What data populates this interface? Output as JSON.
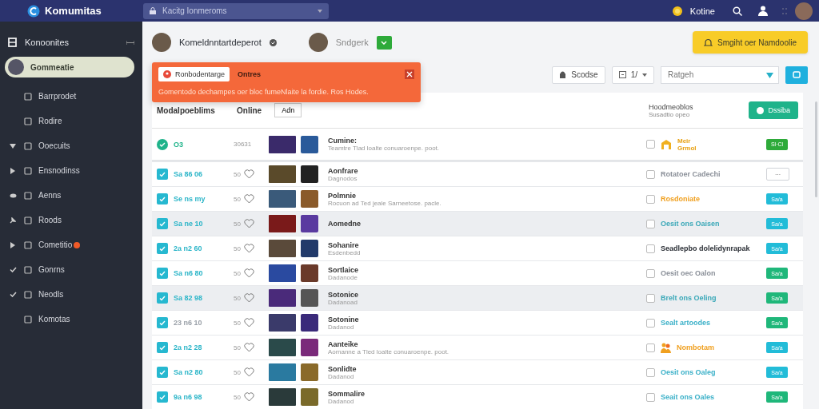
{
  "topbar": {
    "brand": "Komumitas",
    "search": {
      "placeholder": "Kacitg Ionmeroms"
    },
    "status": "Kotine"
  },
  "sidebar": {
    "title": "Konoonites",
    "items": [
      {
        "label": "Gommeatie",
        "selected": true,
        "alert": false
      },
      {
        "label": "Barrprodet",
        "selected": false,
        "kind": "plain",
        "alert": false
      },
      {
        "label": "Rodire",
        "selected": false,
        "kind": "plain",
        "alert": false
      },
      {
        "label": "Ooecuits",
        "selected": false,
        "kind": "expanded",
        "alert": false
      },
      {
        "label": "Ensnodinss",
        "selected": false,
        "kind": "collapsed",
        "alert": false
      },
      {
        "label": "Aenns",
        "selected": false,
        "kind": "watched",
        "alert": false
      },
      {
        "label": "Roods",
        "selected": false,
        "kind": "pinned",
        "alert": false
      },
      {
        "label": "Cometitio",
        "selected": false,
        "kind": "collapsed",
        "alert": true
      },
      {
        "label": "Gonrns",
        "selected": false,
        "kind": "done",
        "alert": false
      },
      {
        "label": "Neodls",
        "selected": false,
        "kind": "done",
        "alert": false
      },
      {
        "label": "Komotas",
        "selected": false,
        "kind": "plain",
        "alert": false
      }
    ]
  },
  "header": {
    "users": [
      {
        "name": "Komeldnntartdeperot",
        "verified": true
      },
      {
        "name": "Sndgerk",
        "verified": false
      }
    ],
    "primary_button": "Smgiht oer Namdoolie"
  },
  "toast": {
    "tag": "Ronbodentarge",
    "title": "Ontres",
    "message": "Gomentodo dechampes oer bloc fumeNlaite la fordie. Ros Hodes."
  },
  "toolbar": {
    "sort_button": "Scodse",
    "page_select": "1/",
    "search": {
      "placeholder": "Ratgeh"
    }
  },
  "table": {
    "columns": [
      "Modalpoeblims",
      "Online"
    ],
    "filter_button": "Adn",
    "summary": {
      "title": "Hoodmeoblos",
      "subtitle": "Susadtio opeo"
    },
    "action_button": "Dssiba",
    "featured": {
      "code": "O3",
      "count": "30631",
      "title": "Cumine:",
      "subtitle": "Teamtre Tlad loalte conuaroenpe. poot.",
      "checked": false,
      "status": [
        "Meir",
        "Grmol"
      ],
      "badge": "Sl·Cl"
    },
    "rows": [
      {
        "checked": true,
        "date": {
          "text": "Sa 86 06",
          "color": "#2bb5c8"
        },
        "count": "50",
        "title": "Aonfrare",
        "subtitle": "Dagnodos",
        "status": {
          "text": "Rotatoer Cadechi",
          "color": "#8a8f98",
          "icon": false
        },
        "fav": false,
        "pick": false,
        "badge": {
          "text": "···",
          "kind": "outline",
          "color": "#ffffff"
        },
        "shade": false
      },
      {
        "checked": true,
        "date": {
          "text": "Se ns my",
          "color": "#2bb5c8"
        },
        "count": "50",
        "title": "Polmnie",
        "subtitle": "Rocuon ad Ted jeale Sarneetose. pacle.",
        "status": {
          "text": "Rosdoniate",
          "color": "#f0a020",
          "icon": false
        },
        "fav": false,
        "pick": false,
        "badge": {
          "text": "Sa/a",
          "kind": "solid",
          "color": "#22bcd8"
        },
        "shade": false
      },
      {
        "checked": true,
        "date": {
          "text": "Sa ne 10",
          "color": "#2bb5c8"
        },
        "count": "50",
        "title": "Aomedne",
        "status": {
          "text": "Oesit ons Oaisen",
          "color": "#3aa8b8",
          "icon": false
        },
        "fav": false,
        "pick": false,
        "badge": {
          "text": "Sa/a",
          "kind": "solid",
          "color": "#22bcd8"
        },
        "shade": true
      },
      {
        "checked": true,
        "date": {
          "text": "2a n2 60",
          "color": "#2bb5c8"
        },
        "count": "50",
        "title": "Sohanire",
        "subtitle": "Esdenbedd",
        "status": {
          "text": "Seadlepbo dolelidynrapak",
          "color": "#2a2e35",
          "icon": false
        },
        "fav": false,
        "pick": false,
        "badge": {
          "text": "Sa/a",
          "kind": "solid",
          "color": "#22bcd8"
        },
        "shade": false
      },
      {
        "checked": true,
        "date": {
          "text": "Sa n6 80",
          "color": "#2bb5c8"
        },
        "count": "50",
        "title": "Sortlaice",
        "subtitle": "Dadanode",
        "status": {
          "text": "Oesit oec Oalon",
          "color": "#8a8f98",
          "icon": false
        },
        "fav": false,
        "pick": false,
        "badge": {
          "text": "Sa/a",
          "kind": "solid",
          "color": "#1fb77a"
        },
        "shade": false
      },
      {
        "checked": true,
        "date": {
          "text": "Sa 82 98",
          "color": "#2bb5c8"
        },
        "count": "50",
        "title": "Sotonice",
        "subtitle": "Dadanoad",
        "status": {
          "text": "Brelt ons Oeling",
          "color": "#3aa8b8",
          "icon": false
        },
        "fav": false,
        "pick": false,
        "badge": {
          "text": "Sa/a",
          "kind": "solid",
          "color": "#1fb77a"
        },
        "shade": true
      },
      {
        "checked": true,
        "date": {
          "text": "23 n6 10",
          "color": "#9aa0a8"
        },
        "count": "50",
        "title": "Sotonine",
        "subtitle": "Dadanod",
        "status": {
          "text": "Sealt artoodes",
          "color": "#3ab0c8",
          "icon": false
        },
        "fav": false,
        "pick": false,
        "badge": {
          "text": "Sa/a",
          "kind": "solid",
          "color": "#1fb77a"
        },
        "shade": false
      },
      {
        "checked": true,
        "date": {
          "text": "2a n2 28",
          "color": "#2bb5c8"
        },
        "count": "50",
        "title": "Aanteike",
        "subtitle": "Aomanne a Tled loalte conuaroenpe. poot.",
        "status": {
          "text": "Nombotam",
          "color": "#f0a020",
          "icon": true
        },
        "fav": false,
        "pick": false,
        "badge": {
          "text": "Sa/a",
          "kind": "solid",
          "color": "#22bcd8"
        },
        "shade": false
      },
      {
        "checked": true,
        "date": {
          "text": "Sa n2 80",
          "color": "#2bb5c8"
        },
        "count": "50",
        "title": "Sonlidte",
        "subtitle": "Dadanod",
        "status": {
          "text": "Oesit ons Oaleg",
          "color": "#3ab0c8",
          "icon": false
        },
        "fav": false,
        "pick": false,
        "badge": {
          "text": "Sa/a",
          "kind": "solid",
          "color": "#22bcd8"
        },
        "shade": false
      },
      {
        "checked": true,
        "date": {
          "text": "9a n6 98",
          "color": "#2bb5c8"
        },
        "count": "50",
        "title": "Sommalire",
        "subtitle": "Dadanod",
        "status": {
          "text": "Seait ons Oales",
          "color": "#3ab0c8",
          "icon": false
        },
        "fav": false,
        "pick": false,
        "badge": {
          "text": "Sa/a",
          "kind": "solid",
          "color": "#1fb77a"
        },
        "shade": false
      }
    ]
  }
}
